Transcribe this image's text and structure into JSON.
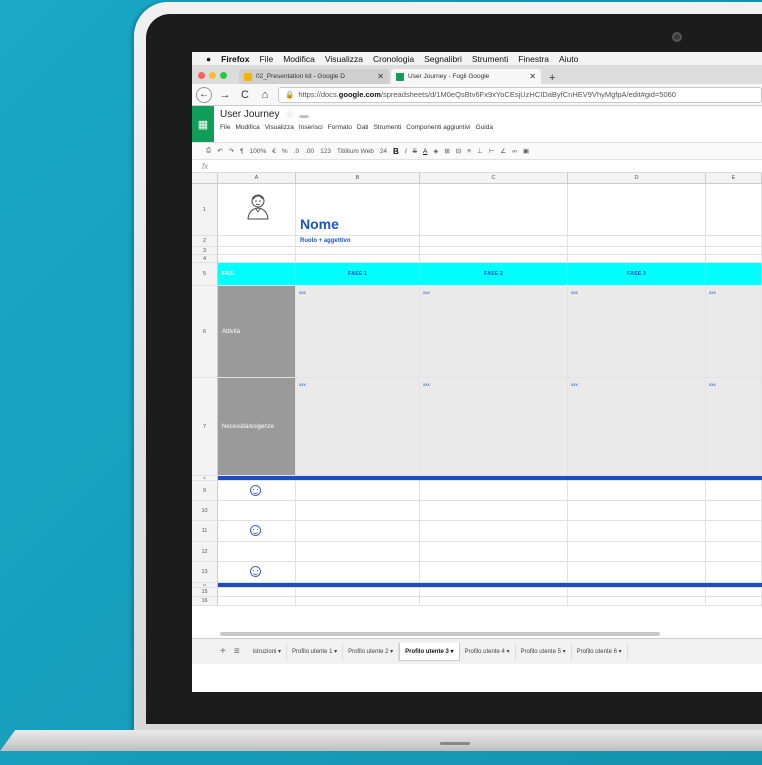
{
  "menubar": {
    "apple": "",
    "app": "Firefox",
    "items": [
      "File",
      "Modifica",
      "Visualizza",
      "Cronologia",
      "Segnalibri",
      "Strumenti",
      "Finestra",
      "Aiuto"
    ]
  },
  "tabs": [
    {
      "label": "02_Presentation kit - Google D",
      "close": "✕",
      "color": "#f4b400"
    },
    {
      "label": "User Journey - Fogli Google",
      "close": "✕",
      "color": "#0f9d58"
    }
  ],
  "newtab": "+",
  "nav": {
    "back": "←",
    "forward": "→",
    "reload": "C",
    "home": "⌂",
    "url_prefix": "https://docs.",
    "url_domain": "google.com",
    "url_rest": "/spreadsheets/d/1M0eQsBtv6Fx9xYoCEsjUzHCIDaByfCnHEV9VhyMgfpA/edit#gid=5060"
  },
  "sheet": {
    "title": "User Journey",
    "menus": [
      "File",
      "Modifica",
      "Visualizza",
      "Inserisci",
      "Formato",
      "Dati",
      "Strumenti",
      "Componenti aggiuntivi",
      "Guida"
    ],
    "toolbar": [
      "100%",
      "€",
      "%",
      ".0",
      ".00",
      "123",
      "Titillium Web",
      "24",
      "B",
      "I",
      "S",
      "A"
    ],
    "fx": "fx"
  },
  "columns": [
    "A",
    "B",
    "C",
    "D",
    "E"
  ],
  "rows": {
    "r1": "1",
    "r2": "2",
    "r3": "3",
    "r4": "4",
    "r5": "5",
    "r6": "6",
    "r7": "7",
    "r8": "8",
    "r9": "9",
    "r10": "10",
    "r11": "11",
    "r12": "12",
    "r13": "13",
    "r14": "14",
    "r15": "15",
    "r16": "16",
    "r17": "17"
  },
  "content": {
    "nome": "Nome",
    "ruolo": "Ruolo + aggettivo",
    "fasi": "FASI",
    "fase1": "FASE 1",
    "fase2": "FASE 2",
    "fase3": "FASE 3",
    "attivita": "Attività",
    "necessita": "Necessità/esigenze",
    "placeholder": "xxx"
  },
  "sheet_tabs": [
    {
      "label": "istruzioni ▾"
    },
    {
      "label": "Profilo utente 1 ▾"
    },
    {
      "label": "Profilo utente 2 ▾"
    },
    {
      "label": "Profilo utente 3 ▾",
      "active": true
    },
    {
      "label": "Profilo utente 4 ▾"
    },
    {
      "label": "Profilo utente 5 ▾"
    },
    {
      "label": "Profilo utente 6 ▾"
    }
  ],
  "sheet_tab_controls": {
    "add": "+",
    "all": "≡"
  }
}
